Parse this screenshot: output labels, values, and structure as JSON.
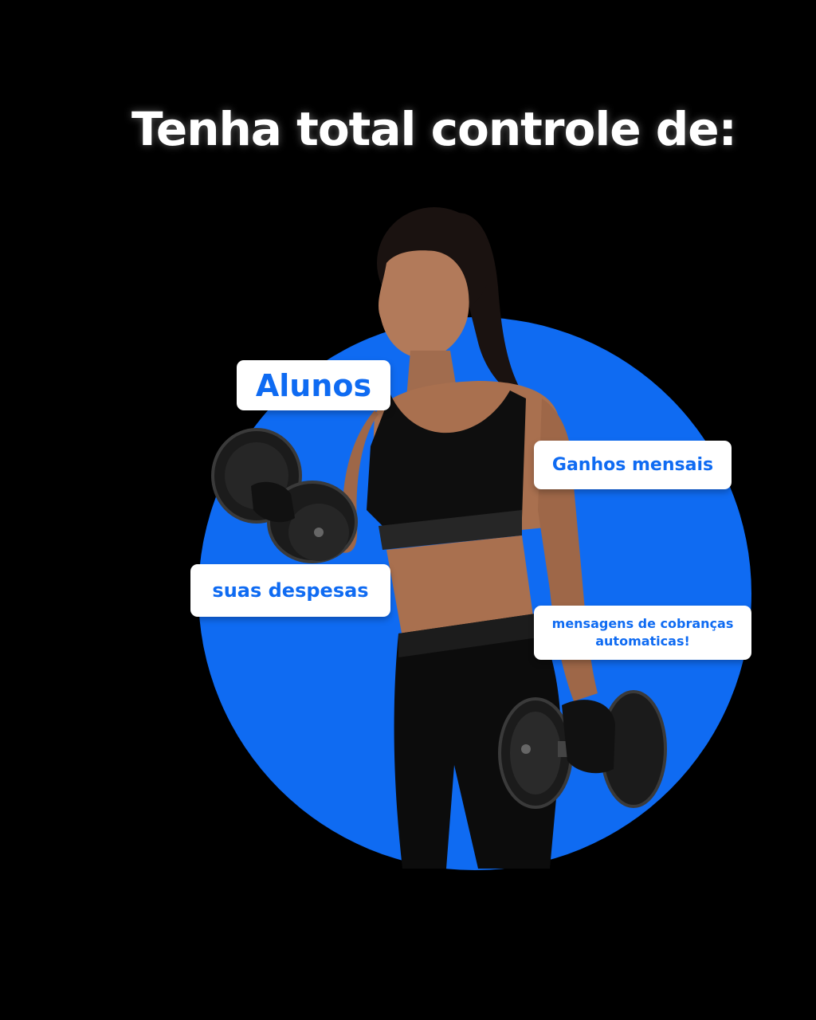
{
  "headline": "Tenha total controle de:",
  "tags": {
    "students": "Alunos",
    "monthly_earnings": "Ganhos mensais",
    "expenses": "suas despesas",
    "messages_line1": "mensagens de cobranças",
    "messages_line2": "automaticas!"
  },
  "colors": {
    "background": "#000000",
    "accent": "#0f6bf2",
    "headline": "#ffffff",
    "tag_background": "#ffffff",
    "tag_text": "#0f6bf2"
  },
  "image": {
    "subject": "woman-lifting-dumbbells-photo"
  }
}
